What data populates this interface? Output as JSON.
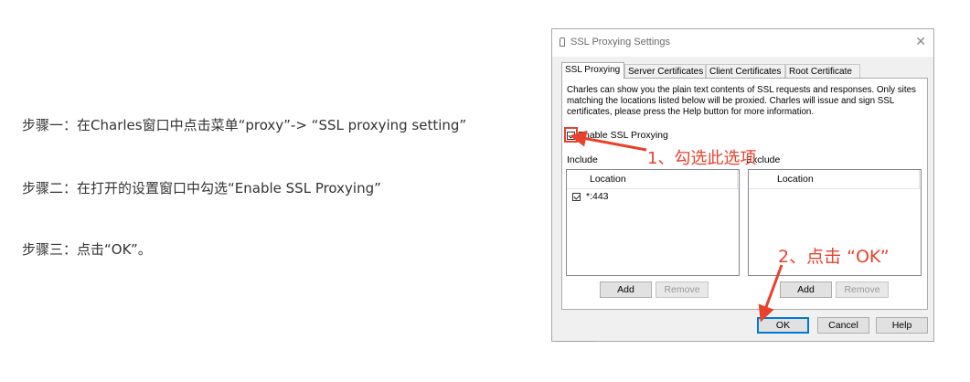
{
  "steps": [
    {
      "prefix": "步骤一：",
      "text": "在Charles窗口中点击菜单“proxy”-> “SSL proxying setting”"
    },
    {
      "prefix": "步骤二：",
      "text": "在打开的设置窗口中勾选“Enable SSL Proxying”"
    },
    {
      "prefix": "步骤三：",
      "text": "点击“OK”。"
    }
  ],
  "dialog": {
    "title": "SSL Proxying Settings",
    "close_glyph": "✕",
    "tabs": [
      "SSL Proxying",
      "Server Certificates",
      "Client Certificates",
      "Root Certificate"
    ],
    "description": "Charles can show you the plain text contents of SSL requests and responses. Only sites matching the locations listed below will be proxied. Charles will issue and sign SSL certificates, please press the Help button for more information.",
    "enable_label": "Enable SSL Proxying",
    "enable_checked": true,
    "include": {
      "label": "Include",
      "column": "Location",
      "rows": [
        {
          "checked": true,
          "value": "*:443"
        }
      ],
      "add_label": "Add",
      "remove_label": "Remove"
    },
    "exclude": {
      "label": "Exclude",
      "column": "Location",
      "rows": [],
      "add_label": "Add",
      "remove_label": "Remove"
    },
    "buttons": {
      "ok": "OK",
      "cancel": "Cancel",
      "help": "Help"
    }
  },
  "annotations": {
    "step1": "1、勾选此选项",
    "step2": "2、点击 “OK”",
    "color": "#e8412c"
  },
  "icons": {
    "app": "lock-icon",
    "close": "close-icon",
    "check": "check-icon"
  }
}
